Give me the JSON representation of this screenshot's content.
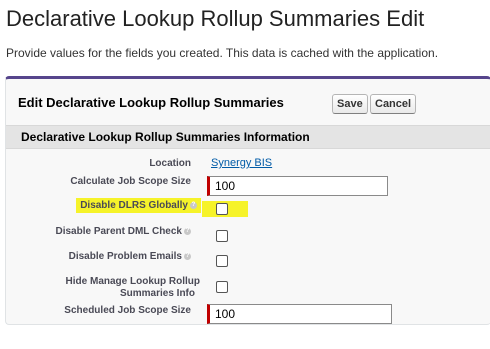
{
  "page": {
    "title": "Declarative Lookup Rollup Summaries Edit",
    "description": "Provide values for the fields you created. This data is cached with the application."
  },
  "panel": {
    "title": "Edit Declarative Lookup Rollup Summaries",
    "save_label": "Save",
    "cancel_label": "Cancel"
  },
  "section": {
    "title": "Declarative Lookup Rollup Summaries Information"
  },
  "fields": {
    "location": {
      "label": "Location",
      "value": "Synergy BIS"
    },
    "calculate_job_scope_size": {
      "label": "Calculate Job Scope Size",
      "value": "100"
    },
    "disable_dlrs_globally": {
      "label": "Disable DLRS Globally",
      "checked": false
    },
    "disable_parent_dml_check": {
      "label": "Disable Parent DML Check",
      "checked": false
    },
    "disable_problem_emails": {
      "label": "Disable Problem Emails",
      "checked": false
    },
    "hide_manage_lookup_rollup": {
      "label_line1": "Hide Manage Lookup Rollup",
      "label_line2": "Summaries Info",
      "checked": false
    },
    "scheduled_job_scope_size": {
      "label": "Scheduled Job Scope Size",
      "value": "100"
    }
  },
  "colors": {
    "accent": "#56458c",
    "required": "#c00000",
    "highlight": "#f6f32a",
    "link": "#015ba7"
  },
  "icons": {
    "help": "help-icon"
  }
}
